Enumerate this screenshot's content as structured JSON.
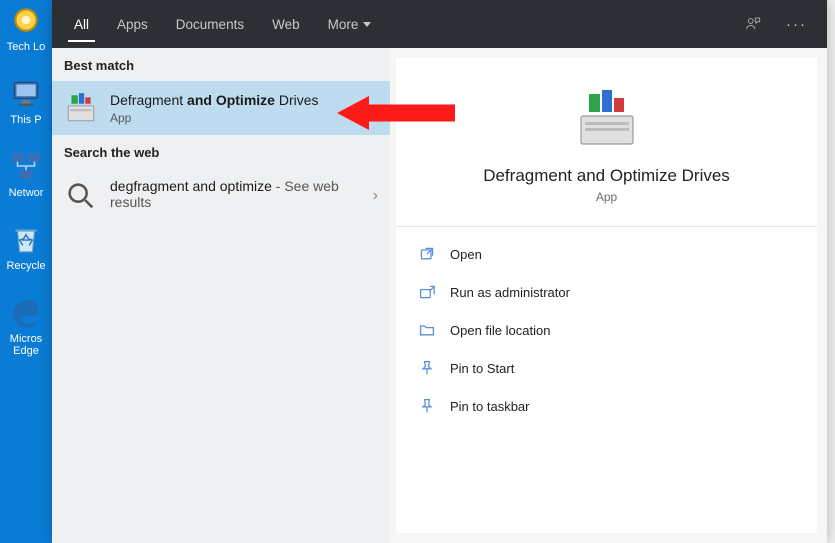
{
  "desktop_icons": [
    {
      "label": "Tech Lo"
    },
    {
      "label": "This P"
    },
    {
      "label": "Networ"
    },
    {
      "label": "Recycle"
    },
    {
      "label": "Micros Edge"
    }
  ],
  "tabs": {
    "all": "All",
    "apps": "Apps",
    "documents": "Documents",
    "web": "Web",
    "more": "More"
  },
  "left": {
    "best_match_header": "Best match",
    "best_match": {
      "title_pre": "Defragment ",
      "title_bold": "and Optimize",
      "title_post": " Drives",
      "sub": "App"
    },
    "web_header": "Search the web",
    "web_result": {
      "title": "degfragment and optimize",
      "suffix": " - See web results"
    }
  },
  "preview": {
    "title": "Defragment and Optimize Drives",
    "sub": "App"
  },
  "actions": {
    "open": "Open",
    "run_admin": "Run as administrator",
    "open_loc": "Open file location",
    "pin_start": "Pin to Start",
    "pin_task": "Pin to taskbar"
  }
}
